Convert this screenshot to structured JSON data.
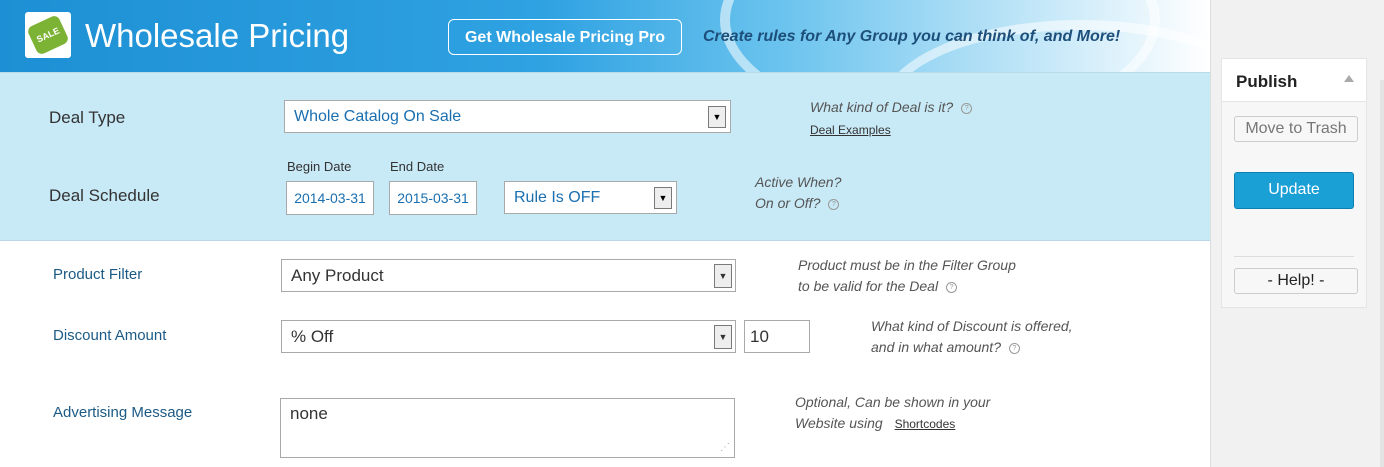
{
  "header": {
    "logo_text": "SALE",
    "title": "Wholesale Pricing",
    "pro_button": "Get Wholesale Pricing Pro",
    "tagline": "Create rules for Any Group you can think of, and More!"
  },
  "deal": {
    "type_label": "Deal Type",
    "type_value": "Whole Catalog On Sale",
    "type_hint": "What kind of Deal is it?",
    "examples_link": "Deal Examples",
    "schedule_label": "Deal Schedule",
    "begin_label": "Begin Date",
    "begin_value": "2014-03-31",
    "end_label": "End Date",
    "end_value": "2015-03-31",
    "rule_value": "Rule Is OFF",
    "active_hint_1": "Active When?",
    "active_hint_2": "On or Off?"
  },
  "product_filter": {
    "label": "Product Filter",
    "value": "Any Product",
    "hint_1": "Product must be in the Filter Group",
    "hint_2": "to be valid for the Deal"
  },
  "discount": {
    "label": "Discount Amount",
    "type_value": "% Off",
    "amount": "10",
    "hint_1": "What kind of Discount is offered,",
    "hint_2": "and in what amount?"
  },
  "advertising": {
    "label": "Advertising Message",
    "value": "none",
    "hint_1": "Optional, Can be shown in your",
    "hint_2": "Website using",
    "shortcodes_link": "Shortcodes"
  },
  "publish": {
    "title": "Publish",
    "trash": "Move to Trash",
    "update": "Update",
    "help": "- Help! -"
  },
  "icons": {
    "help": "help-circle-icon",
    "dropdown": "dropdown-arrow-icon",
    "collapse": "collapse-triangle-icon",
    "logo": "sale-tag-icon",
    "resize": "resize-grip-icon"
  },
  "colors": {
    "banner": "#2fa2e2",
    "panel": "#c8e9f6",
    "update_button": "#1ba0d6",
    "field_text": "#1a6fb0",
    "label_text": "#1c5a86"
  }
}
